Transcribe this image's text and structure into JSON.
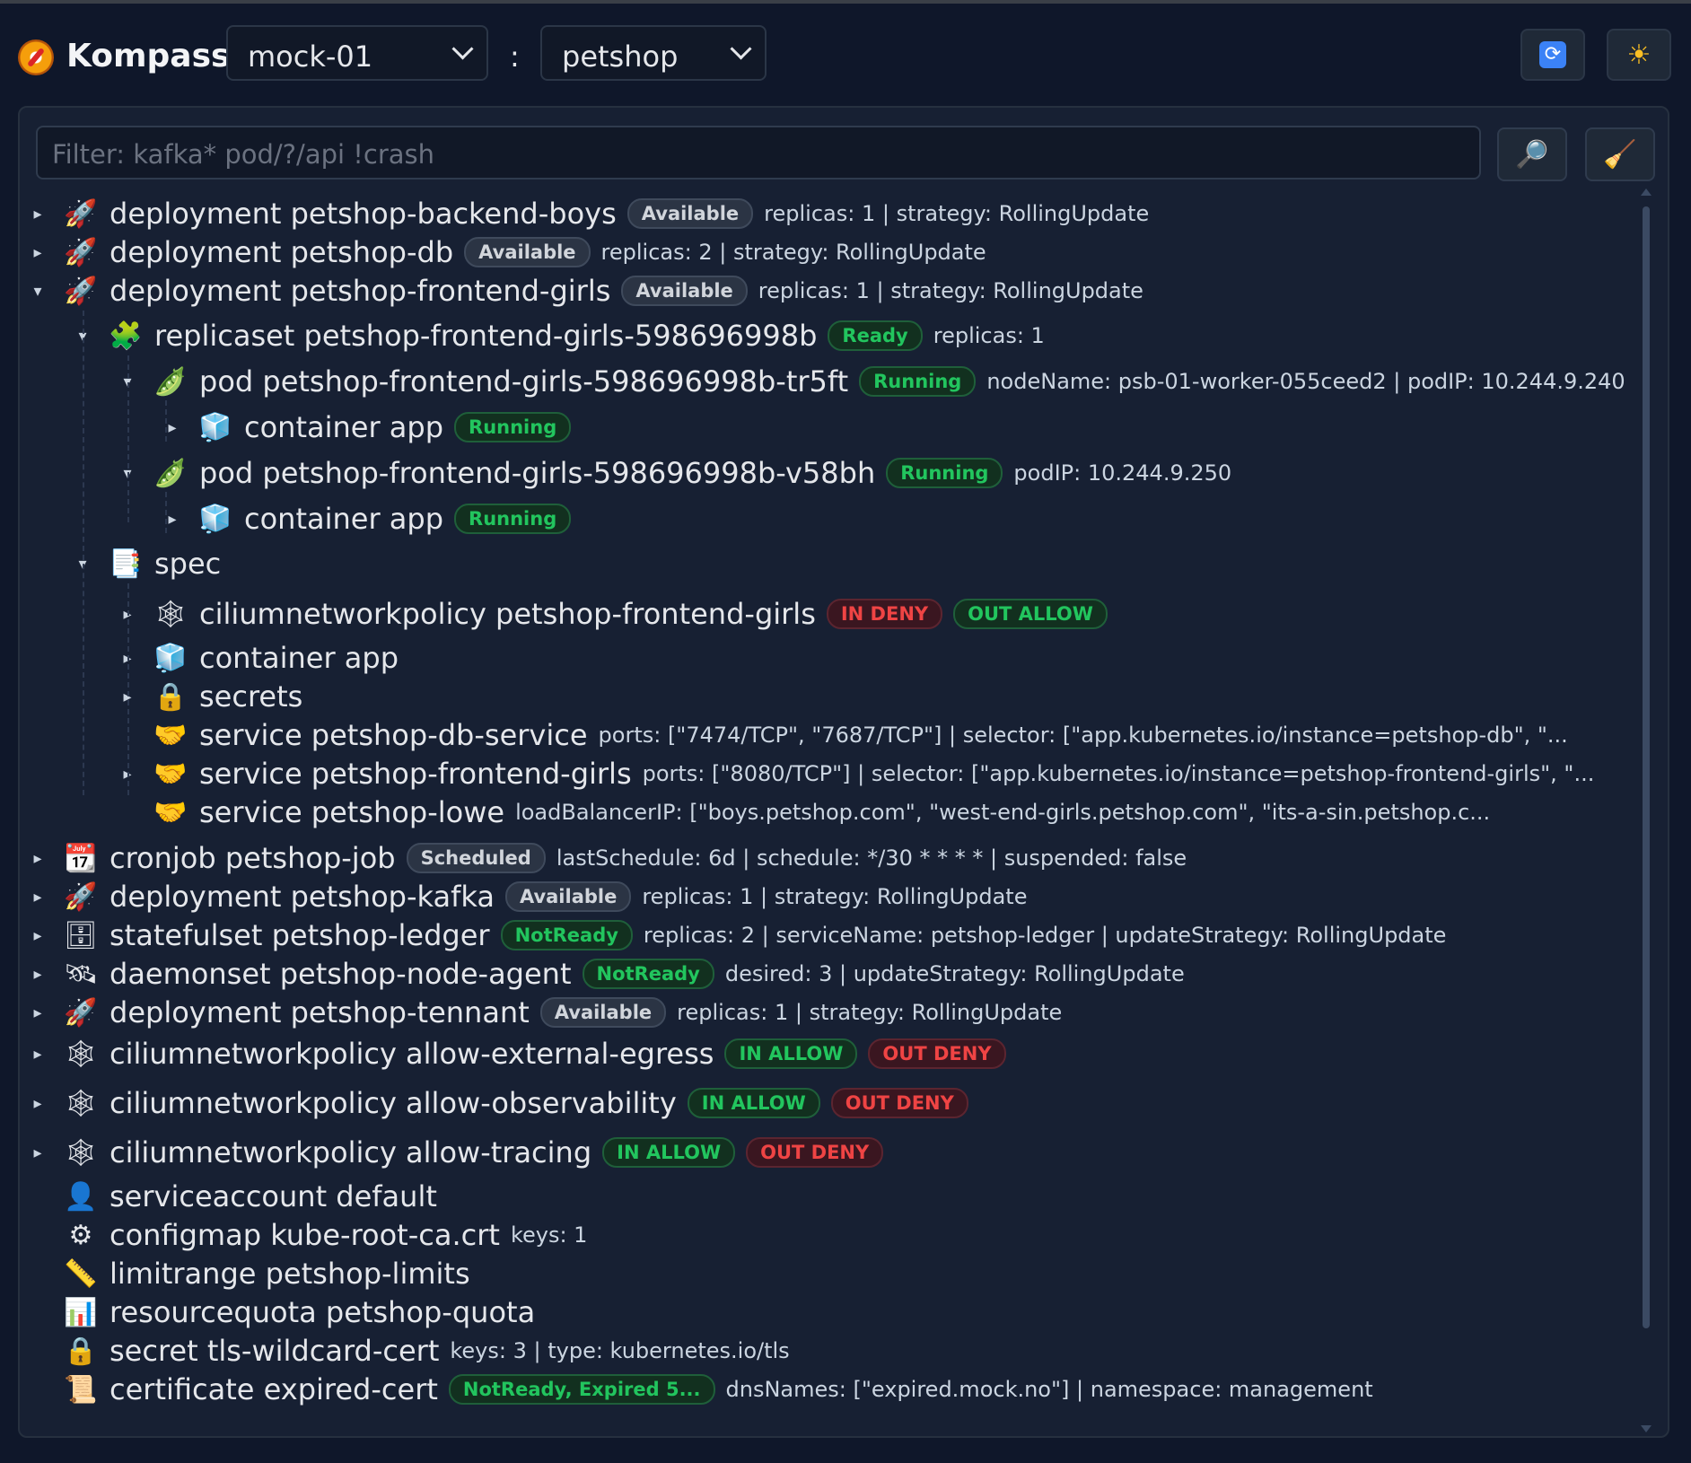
{
  "app": {
    "title": "Kompass"
  },
  "header": {
    "cluster": "mock-01",
    "separator": ":",
    "namespace": "petshop",
    "refresh_icon": "refresh-icon",
    "theme_icon": "sun-icon"
  },
  "filter": {
    "placeholder": "Filter: kafka* pod/?/api !crash",
    "search_icon": "magnifier-icon",
    "clear_icon": "broom-icon"
  },
  "tree": [
    {
      "icon": "🚀",
      "icon_name": "rocket-icon",
      "name": "deployment petshop-backend-boys",
      "badges": [
        {
          "text": "Available",
          "kind": "gray"
        }
      ],
      "meta": "replicas: 1 | strategy: RollingUpdate",
      "arrow": "▸",
      "depth": 0
    },
    {
      "icon": "🚀",
      "icon_name": "rocket-icon",
      "name": "deployment petshop-db",
      "badges": [
        {
          "text": "Available",
          "kind": "gray"
        }
      ],
      "meta": "replicas: 2 | strategy: RollingUpdate",
      "arrow": "▸",
      "depth": 0
    },
    {
      "icon": "🚀",
      "icon_name": "rocket-icon",
      "name": "deployment petshop-frontend-girls",
      "badges": [
        {
          "text": "Available",
          "kind": "gray"
        }
      ],
      "meta": "replicas: 1 | strategy: RollingUpdate",
      "arrow": "▾",
      "depth": 0
    },
    {
      "icon": "🧩",
      "icon_name": "puzzle-icon",
      "name": "replicaset petshop-frontend-girls-598696998b",
      "badges": [
        {
          "text": "Ready",
          "kind": "green"
        }
      ],
      "meta": "replicas: 1",
      "arrow": "▾",
      "depth": 1
    },
    {
      "icon": "🫛",
      "icon_name": "peapod-icon",
      "name": "pod petshop-frontend-girls-598696998b-tr5ft",
      "badges": [
        {
          "text": "Running",
          "kind": "green"
        }
      ],
      "meta": "nodeName: psb-01-worker-055ceed2 | podIP: 10.244.9.240",
      "arrow": "▾",
      "depth": 2
    },
    {
      "icon": "🧊",
      "icon_name": "cube-icon",
      "name": "container app",
      "badges": [
        {
          "text": "Running",
          "kind": "green"
        }
      ],
      "meta": "",
      "arrow": "▸",
      "depth": 3
    },
    {
      "icon": "🫛",
      "icon_name": "peapod-icon",
      "name": "pod petshop-frontend-girls-598696998b-v58bh",
      "badges": [
        {
          "text": "Running",
          "kind": "green"
        }
      ],
      "meta": "podIP: 10.244.9.250",
      "arrow": "▾",
      "depth": 2
    },
    {
      "icon": "🧊",
      "icon_name": "cube-icon",
      "name": "container app",
      "badges": [
        {
          "text": "Running",
          "kind": "green"
        }
      ],
      "meta": "",
      "arrow": "▸",
      "depth": 3
    },
    {
      "icon": "📑",
      "icon_name": "document-icon",
      "name": "spec",
      "badges": [],
      "meta": "",
      "arrow": "▾",
      "depth": 1
    },
    {
      "icon": "🕸",
      "icon_name": "web-icon",
      "name": "ciliumnetworkpolicy petshop-frontend-girls",
      "badges": [
        {
          "text": "IN DENY",
          "kind": "red"
        },
        {
          "text": "OUT ALLOW",
          "kind": "green"
        }
      ],
      "meta": "",
      "arrow": "▸",
      "depth": 2
    },
    {
      "icon": "🧊",
      "icon_name": "cube-icon",
      "name": "container app",
      "badges": [],
      "meta": "",
      "arrow": "▸",
      "depth": 2
    },
    {
      "icon": "🔒",
      "icon_name": "lock-icon",
      "name": "secrets",
      "badges": [],
      "meta": "",
      "arrow": "▸",
      "depth": 2
    },
    {
      "icon": "🤝",
      "icon_name": "handshake-icon",
      "name": "service petshop-db-service",
      "badges": [],
      "meta": "ports: [\"7474/TCP\", \"7687/TCP\"] | selector: [\"app.kubernetes.io/instance=petshop-db\", \"...",
      "arrow": "",
      "depth": 2
    },
    {
      "icon": "🤝",
      "icon_name": "handshake-icon",
      "name": "service petshop-frontend-girls",
      "badges": [],
      "meta": "ports: [\"8080/TCP\"] | selector: [\"app.kubernetes.io/instance=petshop-frontend-girls\", \"...",
      "arrow": "▸",
      "depth": 2
    },
    {
      "icon": "🤝",
      "icon_name": "handshake-icon",
      "name": "service petshop-lowe",
      "badges": [],
      "meta": "loadBalancerIP: [\"boys.petshop.com\", \"west-end-girls.petshop.com\", \"its-a-sin.petshop.c...",
      "arrow": "",
      "depth": 2
    },
    {
      "icon": "📆",
      "icon_name": "calendar-icon",
      "name": "cronjob petshop-job",
      "badges": [
        {
          "text": "Scheduled",
          "kind": "gray"
        }
      ],
      "meta": "lastSchedule: 6d | schedule: */30 * * * * | suspended: false",
      "arrow": "▸",
      "depth": 0
    },
    {
      "icon": "🚀",
      "icon_name": "rocket-icon",
      "name": "deployment petshop-kafka",
      "badges": [
        {
          "text": "Available",
          "kind": "gray"
        }
      ],
      "meta": "replicas: 1 | strategy: RollingUpdate",
      "arrow": "▸",
      "depth": 0
    },
    {
      "icon": "🗄",
      "icon_name": "cabinet-icon",
      "name": "statefulset petshop-ledger",
      "badges": [
        {
          "text": "NotReady",
          "kind": "green"
        }
      ],
      "meta": "replicas: 2 | serviceName: petshop-ledger | updateStrategy: RollingUpdate",
      "arrow": "▸",
      "depth": 0
    },
    {
      "icon": "🛰",
      "icon_name": "satellite-icon",
      "name": "daemonset petshop-node-agent",
      "badges": [
        {
          "text": "NotReady",
          "kind": "green"
        }
      ],
      "meta": "desired: 3 | updateStrategy: RollingUpdate",
      "arrow": "▸",
      "depth": 0
    },
    {
      "icon": "🚀",
      "icon_name": "rocket-icon",
      "name": "deployment petshop-tennant",
      "badges": [
        {
          "text": "Available",
          "kind": "gray"
        }
      ],
      "meta": "replicas: 1 | strategy: RollingUpdate",
      "arrow": "▸",
      "depth": 0
    },
    {
      "icon": "🕸",
      "icon_name": "web-icon",
      "name": "ciliumnetworkpolicy allow-external-egress",
      "badges": [
        {
          "text": "IN ALLOW",
          "kind": "green"
        },
        {
          "text": "OUT DENY",
          "kind": "red"
        }
      ],
      "meta": "",
      "arrow": "▸",
      "depth": 0
    },
    {
      "icon": "🕸",
      "icon_name": "web-icon",
      "name": "ciliumnetworkpolicy allow-observability",
      "badges": [
        {
          "text": "IN ALLOW",
          "kind": "green"
        },
        {
          "text": "OUT DENY",
          "kind": "red"
        }
      ],
      "meta": "",
      "arrow": "▸",
      "depth": 0
    },
    {
      "icon": "🕸",
      "icon_name": "web-icon",
      "name": "ciliumnetworkpolicy allow-tracing",
      "badges": [
        {
          "text": "IN ALLOW",
          "kind": "green"
        },
        {
          "text": "OUT DENY",
          "kind": "red"
        }
      ],
      "meta": "",
      "arrow": "▸",
      "depth": 0
    },
    {
      "icon": "👤",
      "icon_name": "user-icon",
      "name": "serviceaccount default",
      "badges": [],
      "meta": "",
      "arrow": "",
      "depth": 0
    },
    {
      "icon": "⚙",
      "icon_name": "gear-icon",
      "name": "configmap kube-root-ca.crt",
      "badges": [],
      "meta": "keys: 1",
      "arrow": "",
      "depth": 0
    },
    {
      "icon": "📏",
      "icon_name": "ruler-icon",
      "name": "limitrange petshop-limits",
      "badges": [],
      "meta": "",
      "arrow": "",
      "depth": 0
    },
    {
      "icon": "📊",
      "icon_name": "barchart-icon",
      "name": "resourcequota petshop-quota",
      "badges": [],
      "meta": "",
      "arrow": "",
      "depth": 0
    },
    {
      "icon": "🔒",
      "icon_name": "lock-icon",
      "name": "secret tls-wildcard-cert",
      "badges": [],
      "meta": "keys: 3 | type: kubernetes.io/tls",
      "arrow": "",
      "depth": 0
    },
    {
      "icon": "📜",
      "icon_name": "scroll-icon",
      "name": "certificate expired-cert",
      "badges": [
        {
          "text": "NotReady, Expired 5...",
          "kind": "green"
        }
      ],
      "meta": "dnsNames: [\"expired.mock.no\"] | namespace: management",
      "arrow": "",
      "depth": 0
    }
  ]
}
